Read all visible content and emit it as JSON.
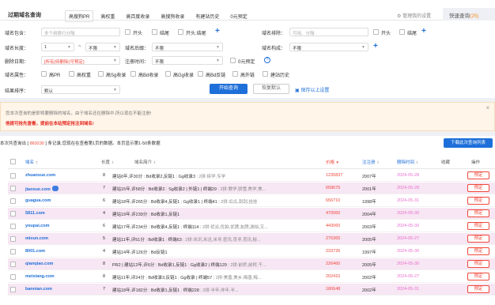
{
  "header": {
    "title": "过期域名查询",
    "quick_tabs": [
      "高搜狗PR",
      "高权重",
      "高百度收录",
      "高搜狗收录",
      "有建站历史",
      "0元预定"
    ],
    "manage_link": "管理我的设置",
    "quick_query_label": "快速查询",
    "quick_query_count": "(25)"
  },
  "filters": {
    "contains_label": "域名包含：",
    "contains_placeholder": "多个用换行分隔",
    "cb_start": "开头",
    "cb_end": "结尾",
    "cb_start_end": "开头.结尾",
    "exclude_label": "域名排除：",
    "exclude_placeholder": "可用、分隔",
    "ex_cb_start": "开头",
    "ex_cb_end": "结尾",
    "length_label": "域名长度：",
    "length_min": "1",
    "length_sep": "~",
    "length_max": "不限",
    "suffix_label": "域名后缀：",
    "suffix_value": "不限",
    "struct_label": "域名构成：",
    "struct_value": "不限",
    "del_date_label": "删除日期：",
    "del_date_value": "[所有]待删除(可预定)",
    "reg_time_label": "注册时间：",
    "reg_time_value": "不限",
    "zero_reserve": "0元预定",
    "attr_label": "域名属性：",
    "attrs": [
      "高PR",
      "高权重",
      "高Sg收录",
      "高Bd收录",
      "高Gg收录",
      "高Bd反链",
      "高外链",
      "建站历史"
    ],
    "sort_label": "结果排序：",
    "sort_value": "默认",
    "btn_search": "开始查询",
    "btn_reset": "恢复默认",
    "save_link": "保存以上设置"
  },
  "notice": {
    "line1": "您本次查询的是即将要删除的域名，由于域名还在删除中,所以现在不能注册!",
    "line2": "他提可抢先查看，提前在本站预定抢注到域名!"
  },
  "summary": {
    "prefix": "本次共查询出 [",
    "count": " 869230 ",
    "suffix": "] 条记录,您现在在查看第1页的数据。本页显示第1-50条数据",
    "download": "下载此次查询列表"
  },
  "columns": {
    "domain": "域名",
    "length": "长度",
    "intro": "域名简介",
    "price": "价格",
    "reg_year": "注注册",
    "del_time": "删除时间",
    "fav": "收藏",
    "op": "操作"
  },
  "rows": [
    {
      "domain": "zhuanxue.com",
      "length": "8",
      "intro": "建站6年,评30分",
      "intro_b": "Bd收录2,反链1",
      "intro_c": "Gg收录3",
      "intro_tail": "2拼:砖学,专学",
      "price": "1235837",
      "year": "2007年",
      "date": "2024-05-28",
      "op": "预定"
    },
    {
      "domain": "jiaoxue.com",
      "length": "7",
      "intro": "建站15年,评58分",
      "intro_b": "Bd收录2",
      "intro_c": "Sg收录2 | 外链1 | 终端29",
      "intro_tail": "2拼:教学,骄雪,焦学,焦...",
      "price": "658675",
      "year": "2001年",
      "date": "2024-05-28",
      "op": "预定"
    },
    {
      "domain": "guagua.com",
      "length": "6",
      "intro": "建站18年,评265分",
      "intro_b": "Bd收录4,反链1",
      "intro_c": "Gg收录1 | 终端41",
      "intro_tail": "2拼:瓜瓜,刮刮,挂挂",
      "price": "656710",
      "year": "1998年",
      "date": "2024-05-31",
      "op": "预定"
    },
    {
      "domain": "5811.com",
      "length": "4",
      "intro": "建站19年,评239分",
      "intro_b": "Bd收录1,反链1",
      "intro_c": "",
      "intro_tail": "",
      "price": "470060",
      "year": "2004年",
      "date": "2024-05-30",
      "op": "预定"
    },
    {
      "domain": "youpai.com",
      "length": "6",
      "intro": "建站17年,评234分",
      "intro_b": "Bd收录4,反链1",
      "intro_c": "终端114",
      "intro_tail": "2拼:优派,优拍,优牌,友牌,游拍,又...",
      "price": "443060",
      "year": "2003年",
      "date": "2024-05-30",
      "op": "预定"
    },
    {
      "domain": "mixun.com",
      "length": "5",
      "intro": "建站11年,评51分",
      "intro_b": "Bd收录1",
      "intro_c": "终端63",
      "intro_tail": "2拼:米讯,米迅,米寻,密讯,觅寻,觅讯,秘...",
      "price": "275365",
      "year": "2005年",
      "date": "2024-05-27",
      "op": "预定"
    },
    {
      "domain": "8001.com",
      "length": "4",
      "intro": "建站14年,评126分",
      "intro_b": "Bd反链1",
      "intro_c": "",
      "intro_tail": "",
      "price": "233726",
      "year": "1997年",
      "date": "2024-05-30",
      "op": "预定"
    },
    {
      "domain": "qianqiao.com",
      "length": "8",
      "intro": "PR2 | 建站12年,评6分",
      "intro_b": "Bd收录1,反链1",
      "intro_c": "Gg收录2 | 终端129",
      "intro_tail": "2拼:前侨,前桥,千...",
      "price": "226460",
      "year": "2005年",
      "date": "2024-05-30",
      "op": "预定"
    },
    {
      "domain": "meixiang.com",
      "length": "8",
      "intro": "建站11年,评24分",
      "intro_b": "Bd收录3,反链1",
      "intro_c": "Gg收录 | 终端57",
      "intro_tail": "2拼:美香,美乡,梅香,梅...",
      "price": "202410",
      "year": "2002年",
      "date": "2024-05-27",
      "op": "预定"
    },
    {
      "domain": "bannian.com",
      "length": "7",
      "intro": "建站18年,评182分",
      "intro_b": "Bd收录1,反链1",
      "intro_c": "终端228",
      "intro_tail": "2拼:半年,伴年,半...",
      "price": "180648",
      "year": "2002年",
      "date": "2024-05-31",
      "op": "预定"
    }
  ],
  "colors": {
    "accent": "#1e6fd9",
    "price": "#f0473a",
    "date": "#e86fcf",
    "highlight_row": "#f7e6f3"
  }
}
